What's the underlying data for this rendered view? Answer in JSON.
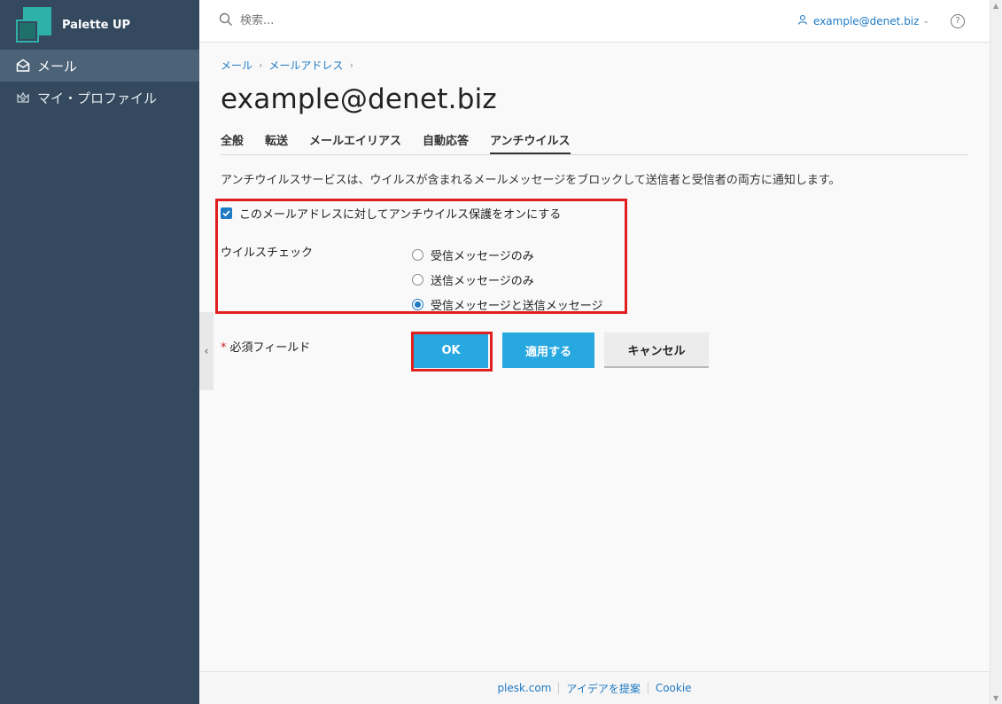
{
  "app": {
    "name": "Palette UP"
  },
  "sidebar": {
    "items": [
      {
        "label": "メール",
        "icon": "mail-icon",
        "active": true
      },
      {
        "label": "マイ・プロファイル",
        "icon": "profile-crown-icon",
        "active": false
      }
    ]
  },
  "header": {
    "search_placeholder": "検索...",
    "user_email": "example@denet.biz",
    "help": "?"
  },
  "breadcrumb": [
    "メール",
    "メールアドレス"
  ],
  "page_title": "example@denet.biz",
  "tabs": [
    "全般",
    "転送",
    "メールエイリアス",
    "自動応答",
    "アンチウイルス"
  ],
  "active_tab": "アンチウイルス",
  "description": "アンチウイルスサービスは、ウイルスが含まれるメールメッセージをブロックして送信者と受信者の両方に通知します。",
  "form": {
    "enable_label": "このメールアドレスに対してアンチウイルス保護をオンにする",
    "enable_checked": true,
    "virus_check_label": "ウイルスチェック",
    "options": [
      "受信メッセージのみ",
      "送信メッセージのみ",
      "受信メッセージと送信メッセージ"
    ],
    "selected_option": "受信メッセージと送信メッセージ",
    "required_label": "必須フィールド",
    "required_star": "*"
  },
  "buttons": {
    "ok": "OK",
    "apply": "適用する",
    "cancel": "キャンセル"
  },
  "footer": {
    "links": [
      "plesk.com",
      "アイデアを提案",
      "Cookie"
    ]
  },
  "colors": {
    "sidebar": "#34495e",
    "accent": "#28a8e0",
    "link": "#1f7ac4",
    "highlight": "#e02020"
  }
}
